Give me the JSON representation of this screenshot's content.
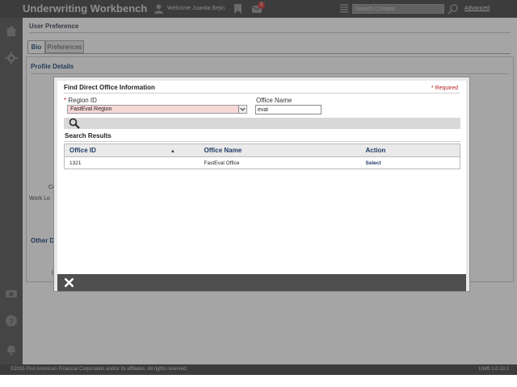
{
  "header": {
    "app_title": "Underwriting Workbench",
    "welcome": "Welcome Juanita Bejin",
    "mail_count": "2",
    "search_placeholder": "Search Content",
    "advanced": "Advanced"
  },
  "sidebar": {
    "icons": [
      "home-icon",
      "gear-icon",
      "phone-icon",
      "help-icon",
      "bell-icon"
    ]
  },
  "page": {
    "breadcrumb": "User Preference",
    "tabs": [
      {
        "label": "Bio",
        "active": true
      },
      {
        "label": "Preferences",
        "active": false
      }
    ],
    "profile_section": "Profile Details",
    "partial_label_1": "Co",
    "partial_label_2": "Work Lo",
    "other_section": "Other D",
    "partial_label_3": "L"
  },
  "modal": {
    "title": "Find Direct Office Information",
    "required_note": "* Required",
    "region_label_mark": "*",
    "region_label": "Region ID",
    "region_value": "FastEval Region",
    "office_label": "Office Name",
    "office_value": "eval",
    "results_title": "Search Results",
    "columns": [
      "Office ID",
      "Office Name",
      "Action"
    ],
    "rows": [
      {
        "office_id": "1321",
        "office_name": "FastEval Office",
        "action": "Select"
      }
    ]
  },
  "footer": {
    "copyright": "©2015 First American Financial Corporation and/or its affiliates. All rights reserved.",
    "version": "UWB 1.0.13.1"
  },
  "colors": {
    "topbar": "#4a4a4a",
    "accent": "#1f3b66",
    "required": "#b22222",
    "error_field": "#f8d7d7"
  }
}
